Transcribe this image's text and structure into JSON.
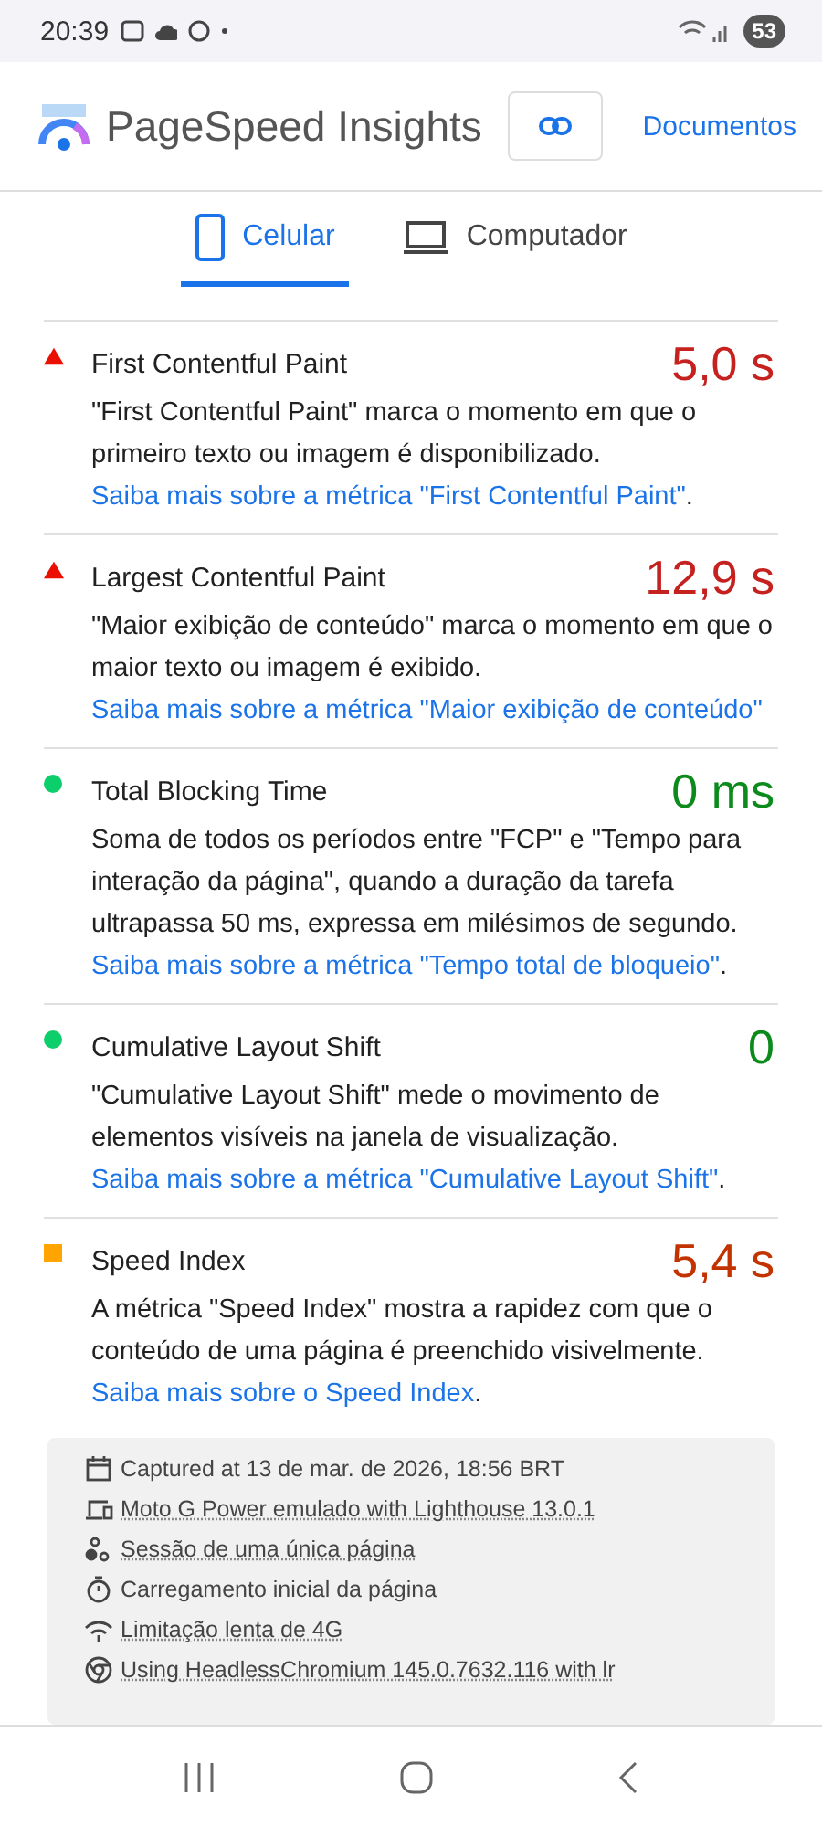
{
  "status_bar": {
    "time": "20:39",
    "battery": "53"
  },
  "header": {
    "title": "PageSpeed Insights",
    "docs_link": "Documentos"
  },
  "tabs": [
    {
      "label": "Celular",
      "selected": true
    },
    {
      "label": "Computador",
      "selected": false
    }
  ],
  "metrics": [
    {
      "kind": "fail",
      "name": "First Contentful Paint",
      "value": "5,0 s",
      "text": "\"First Contentful Paint\" marca o momento em que o primeiro texto ou imagem é disponibilizado. ",
      "link": "Saiba mais sobre a métrica \"First Contentful Paint\"",
      "after": "."
    },
    {
      "kind": "fail",
      "name": "Largest Contentful Paint",
      "value": "12,9 s",
      "text": "\"Maior exibição de conteúdo\" marca o momento em que o maior texto ou imagem é exibido. ",
      "link": "Saiba mais sobre a métrica \"Maior exibição de conteúdo\""
    },
    {
      "kind": "pass",
      "name": "Total Blocking Time",
      "value": "0 ms",
      "text": "Soma de todos os períodos entre \"FCP\" e \"Tempo para interação da página\", quando a duração da tarefa ultrapassa 50 ms, expressa em milésimos de segundo. ",
      "link": "Saiba mais sobre a métrica \"Tempo total de bloqueio\"",
      "after": "."
    },
    {
      "kind": "pass",
      "name": "Cumulative Layout Shift",
      "value": "0",
      "text": "\"Cumulative Layout Shift\" mede o movimento de elementos visíveis na janela de visualização. ",
      "link": "Saiba mais sobre a métrica \"Cumulative Layout Shift\"",
      "after": "."
    },
    {
      "kind": "average",
      "name": "Speed Index",
      "value": "5,4 s",
      "text": "A métrica \"Speed Index\" mostra a rapidez com que o conteúdo de uma página é preenchido visivelmente. ",
      "link": "Saiba mais sobre o Speed Index",
      "after": "."
    }
  ],
  "summary": [
    {
      "kind": "calendar",
      "text": "Captured at 13 de mar. de 2026, 18:56 BRT",
      "dotted": false
    },
    {
      "kind": "devices",
      "text": "Moto G Power emulado with Lighthouse 13.0.1",
      "dotted": true
    },
    {
      "kind": "session",
      "text": "Sessão de uma única página",
      "dotted": true
    },
    {
      "kind": "timer",
      "text": "Carregamento inicial da página",
      "dotted": false
    },
    {
      "kind": "network",
      "text": "Limitação lenta de 4G",
      "dotted": true
    },
    {
      "kind": "browser",
      "text": "Using HeadlessChromium 145.0.7632.116 with lr",
      "dotted": true
    }
  ]
}
